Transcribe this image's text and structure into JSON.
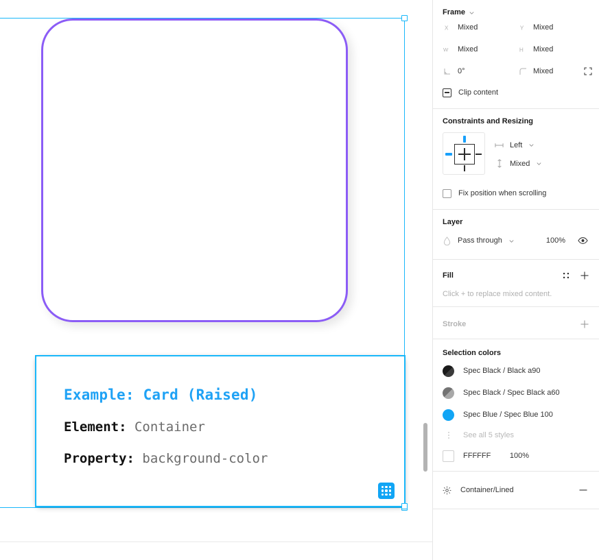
{
  "canvas": {
    "card": {
      "title": "Example: Card (Raised)",
      "rows": [
        {
          "key": "Element:",
          "value": "Container"
        },
        {
          "key": "Property:",
          "value": "background-color"
        }
      ],
      "badge_icon": "grid-dots-icon"
    },
    "shape": {
      "name": "purple-rounded-rect",
      "stroke_color": "#8b5cf6"
    },
    "selection_color": "#18b7fa"
  },
  "panel": {
    "frame": {
      "title": "Frame",
      "fields": [
        {
          "icon": "x-position-icon",
          "label": "X",
          "value": "Mixed"
        },
        {
          "icon": "y-position-icon",
          "label": "Y",
          "value": "Mixed"
        },
        {
          "icon": "width-icon",
          "label": "W",
          "value": "Mixed"
        },
        {
          "icon": "height-icon",
          "label": "H",
          "value": "Mixed"
        },
        {
          "icon": "rotation-icon",
          "label": "",
          "value": "0°"
        },
        {
          "icon": "corner-radius-icon",
          "label": "",
          "value": "Mixed"
        }
      ],
      "independent_corners_icon": "independent-corners-icon",
      "clip_content_label": "Clip content"
    },
    "constraints": {
      "title": "Constraints and Resizing",
      "horizontal": "Left",
      "vertical": "Mixed",
      "fix_position_label": "Fix position when scrolling"
    },
    "layer": {
      "title": "Layer",
      "blend_mode": "Pass through",
      "opacity": "100%",
      "visibility_icon": "eye-icon"
    },
    "fill": {
      "title": "Fill",
      "note": "Click + to replace mixed content.",
      "detach_icon": "style-dots-icon",
      "add_icon": "plus-icon"
    },
    "stroke": {
      "title": "Stroke",
      "add_icon": "plus-icon"
    },
    "selection_colors": {
      "title": "Selection colors",
      "items": [
        {
          "name": "Spec Black / Black a90",
          "color": "#2b2b2b",
          "type": "alpha"
        },
        {
          "name": "Spec Black / Spec Black a60",
          "color": "#8c8c8c",
          "type": "alpha"
        },
        {
          "name": "Spec Blue / Spec Blue 100",
          "color": "#11a5f5",
          "type": "solid"
        }
      ],
      "see_all_label": "See all 5 styles",
      "hex_swatch": {
        "hex": "FFFFFF",
        "opacity": "100%",
        "color": "#ffffff"
      }
    },
    "effects": {
      "name": "Container/Lined",
      "icon": "effects-icon",
      "remove_icon": "minus-icon"
    }
  }
}
